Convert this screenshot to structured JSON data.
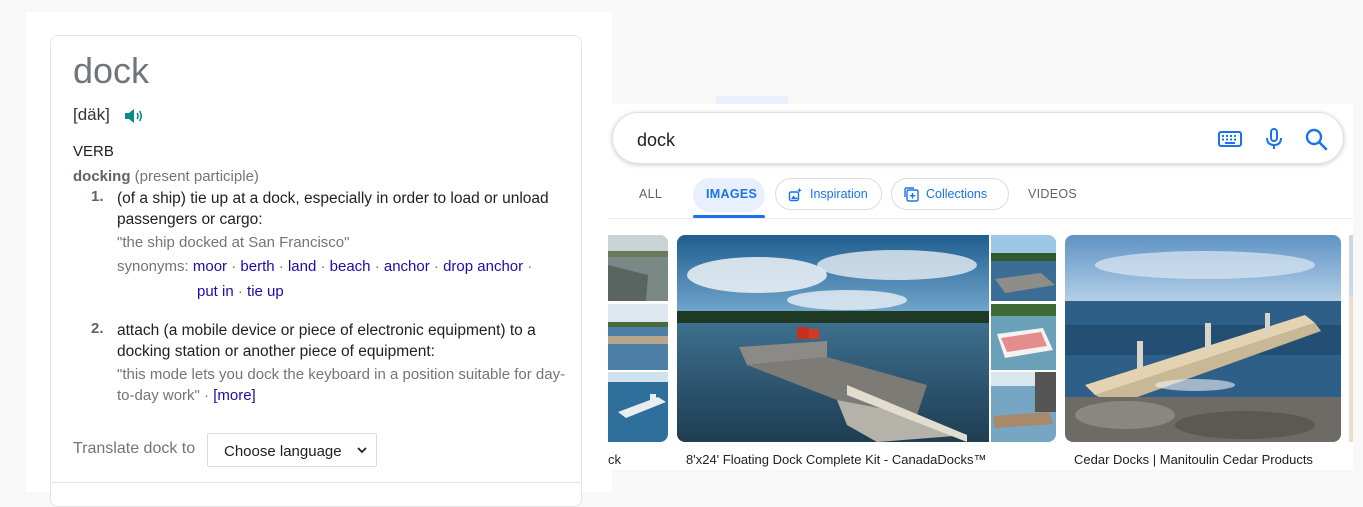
{
  "dictionary": {
    "word": "dock",
    "phonetic": "[däk]",
    "part_of_speech": "VERB",
    "inflection_word": "docking",
    "inflection_note": " (present participle)",
    "senses": [
      {
        "number": "1.",
        "definition": "(of a ship) tie up at a dock, especially in order to load or unload passengers or cargo:",
        "example": "\"the ship docked at San Francisco\"",
        "synonyms_label": "synonyms:",
        "synonyms": [
          "moor",
          "berth",
          "land",
          "beach",
          "anchor",
          "drop anchor",
          "put in",
          "tie up"
        ]
      },
      {
        "number": "2.",
        "definition": "attach (a mobile device or piece of electronic equipment) to a docking station or another piece of equipment:",
        "example": "\"this mode lets you dock the keyboard in a position suitable for day-to-day work\" · ",
        "more_label": "[more]"
      }
    ],
    "translate_label": "Translate dock to",
    "language_select": "Choose language"
  },
  "search": {
    "query": "dock",
    "tabs": {
      "all": "ALL",
      "images": "IMAGES",
      "inspiration": "Inspiration",
      "collections": "Collections",
      "videos": "VIDEOS"
    },
    "results": [
      {
        "caption": "ck"
      },
      {
        "caption": "8'x24' Floating Dock Complete Kit - CanadaDocks™"
      },
      {
        "caption": "Cedar Docks | Manitoulin Cedar Products"
      }
    ]
  },
  "colors": {
    "link": "#1a0dab",
    "accent": "#1a73e8",
    "muted": "#70757a"
  },
  "icons": [
    "speaker-icon",
    "keyboard-icon",
    "microphone-icon",
    "search-icon",
    "inspiration-icon",
    "collections-icon",
    "chevron-down-icon"
  ]
}
